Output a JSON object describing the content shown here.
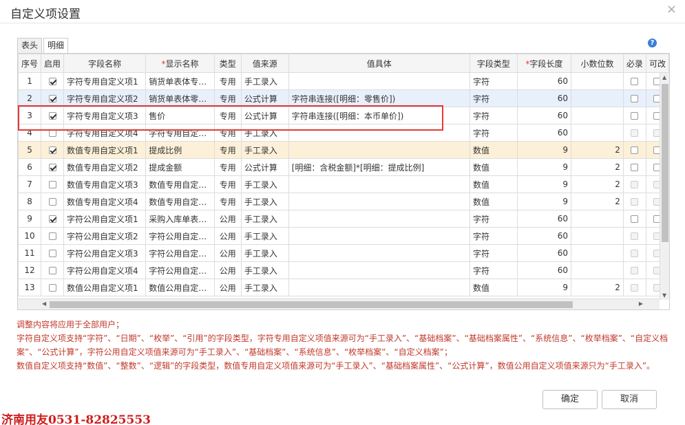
{
  "dialog": {
    "title": "自定义项设置",
    "close_glyph": "×"
  },
  "tabs": [
    {
      "label": "表头"
    },
    {
      "label": "明细"
    }
  ],
  "help_glyph": "?",
  "columns": [
    "序号",
    "启用",
    "字段名称",
    "显示名称",
    "类型",
    "值来源",
    "值具体",
    "字段类型",
    "字段长度",
    "小数位数",
    "必录",
    "可改"
  ],
  "required_mark": "*",
  "rows": [
    {
      "no": "1",
      "enabled": true,
      "field": "字符专用自定义项1",
      "display": "销货单表体专…",
      "type": "专用",
      "source": "手工录入",
      "value": "",
      "ftype": "字符",
      "length": "60",
      "decimals": ""
    },
    {
      "no": "2",
      "enabled": true,
      "field": "字符专用自定义项2",
      "display": "销货单表体零…",
      "type": "专用",
      "source": "公式计算",
      "value": "字符串连接([明细：零售价])",
      "ftype": "字符",
      "length": "60",
      "decimals": ""
    },
    {
      "no": "3",
      "enabled": true,
      "field": "字符专用自定义项3",
      "display": "售价",
      "type": "专用",
      "source": "公式计算",
      "value": "字符串连接([明细：本币单价])",
      "ftype": "字符",
      "length": "60",
      "decimals": ""
    },
    {
      "no": "4",
      "enabled": false,
      "field": "字符专用自定义项4",
      "display": "字符专用自定…",
      "type": "专用",
      "source": "手工录入",
      "value": "",
      "ftype": "字符",
      "length": "60",
      "decimals": ""
    },
    {
      "no": "5",
      "enabled": true,
      "field": "数值专用自定义项1",
      "display": "提成比例",
      "type": "专用",
      "source": "手工录入",
      "value": "",
      "ftype": "数值",
      "length": "9",
      "decimals": "2"
    },
    {
      "no": "6",
      "enabled": true,
      "field": "数值专用自定义项2",
      "display": "提成金额",
      "type": "专用",
      "source": "公式计算",
      "value": "[明细：含税金额]*[明细：提成比例]",
      "ftype": "数值",
      "length": "9",
      "decimals": "2"
    },
    {
      "no": "7",
      "enabled": false,
      "field": "数值专用自定义项3",
      "display": "数值专用自定…",
      "type": "专用",
      "source": "手工录入",
      "value": "",
      "ftype": "数值",
      "length": "9",
      "decimals": "2"
    },
    {
      "no": "8",
      "enabled": false,
      "field": "数值专用自定义项4",
      "display": "数值专用自定…",
      "type": "专用",
      "source": "手工录入",
      "value": "",
      "ftype": "数值",
      "length": "9",
      "decimals": "2"
    },
    {
      "no": "9",
      "enabled": true,
      "field": "字符公用自定义项1",
      "display": "采购入库单表…",
      "type": "公用",
      "source": "手工录入",
      "value": "",
      "ftype": "字符",
      "length": "60",
      "decimals": ""
    },
    {
      "no": "10",
      "enabled": false,
      "field": "字符公用自定义项2",
      "display": "字符公用自定…",
      "type": "公用",
      "source": "手工录入",
      "value": "",
      "ftype": "字符",
      "length": "60",
      "decimals": ""
    },
    {
      "no": "11",
      "enabled": false,
      "field": "字符公用自定义项3",
      "display": "字符公用自定…",
      "type": "公用",
      "source": "手工录入",
      "value": "",
      "ftype": "字符",
      "length": "60",
      "decimals": ""
    },
    {
      "no": "12",
      "enabled": false,
      "field": "字符公用自定义项4",
      "display": "字符公用自定…",
      "type": "公用",
      "source": "手工录入",
      "value": "",
      "ftype": "字符",
      "length": "60",
      "decimals": ""
    },
    {
      "no": "13",
      "enabled": false,
      "field": "数值公用自定义项1",
      "display": "数值公用自定…",
      "type": "公用",
      "source": "手工录入",
      "value": "",
      "ftype": "数值",
      "length": "9",
      "decimals": "2"
    }
  ],
  "notes": [
    "调整内容将应用于全部用户；",
    "字符自定义项支持“字符”、“日期”、“枚举”、“引用”的字段类型，字符专用自定义项值来源可为“手工录入”、“基础档案”、“基础档案属性”、“系统信息”、“枚举档案”、“自定义档案”、“公式计算”，字符公用自定义项值来源可为“手工录入”、“基础档案”、“系统信息”、“枚举档案”、“自定义档案”；",
    "数值自定义项支持“数值”、“整数”、“逻辑”的字段类型，数值专用自定义项值来源可为“手工录入”、“基础档案属性”、“公式计算”，数值公用自定义项值来源只为“手工录入”。"
  ],
  "buttons": {
    "ok": "确定",
    "cancel": "取消"
  },
  "watermark": "济南用友0531-82825553"
}
